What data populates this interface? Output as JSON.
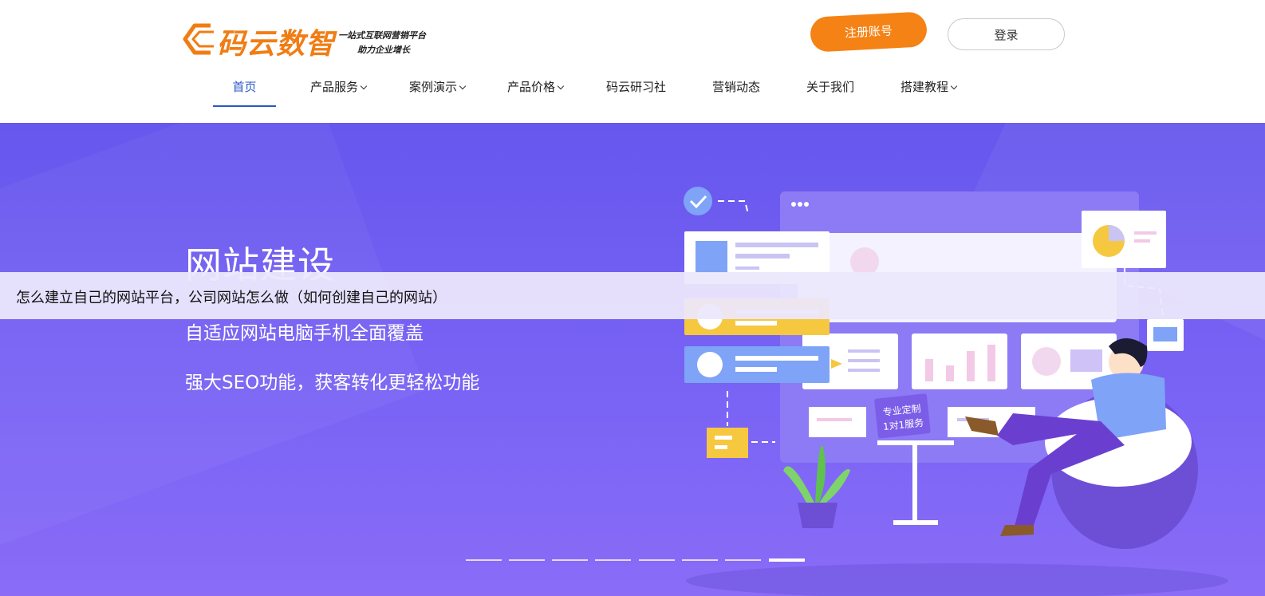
{
  "header": {
    "logo_name": "码云数智",
    "slogan_line1": "一站式互联网营销平台",
    "slogan_line2": "助力企业增长",
    "register_label": "注册账号",
    "login_label": "登录"
  },
  "nav": {
    "items": [
      {
        "label": "首页",
        "active": true,
        "has_dropdown": false
      },
      {
        "label": "产品服务",
        "active": false,
        "has_dropdown": true
      },
      {
        "label": "案例演示",
        "active": false,
        "has_dropdown": true
      },
      {
        "label": "产品价格",
        "active": false,
        "has_dropdown": true
      },
      {
        "label": "码云研习社",
        "active": false,
        "has_dropdown": false
      },
      {
        "label": "营销动态",
        "active": false,
        "has_dropdown": false
      },
      {
        "label": "关于我们",
        "active": false,
        "has_dropdown": false
      },
      {
        "label": "搭建教程",
        "active": false,
        "has_dropdown": true
      }
    ]
  },
  "banner": {
    "title": "网站建设",
    "line1": "自适应网站电脑手机全面覆盖",
    "line2": "强大SEO功能，获客转化更轻松功能",
    "overlay_text": "怎么建立自己的网站平台，公司网站怎么做（如何创建自己的网站）",
    "illustration_badge_line1": "专业定制",
    "illustration_badge_line2": "1对1服务",
    "slide_count": 8,
    "active_slide": 8
  },
  "colors": {
    "brand_orange": "#f07d14",
    "register_button": "#f58214",
    "nav_active": "#2a56c6",
    "banner_purple": "#6f5cf2"
  }
}
